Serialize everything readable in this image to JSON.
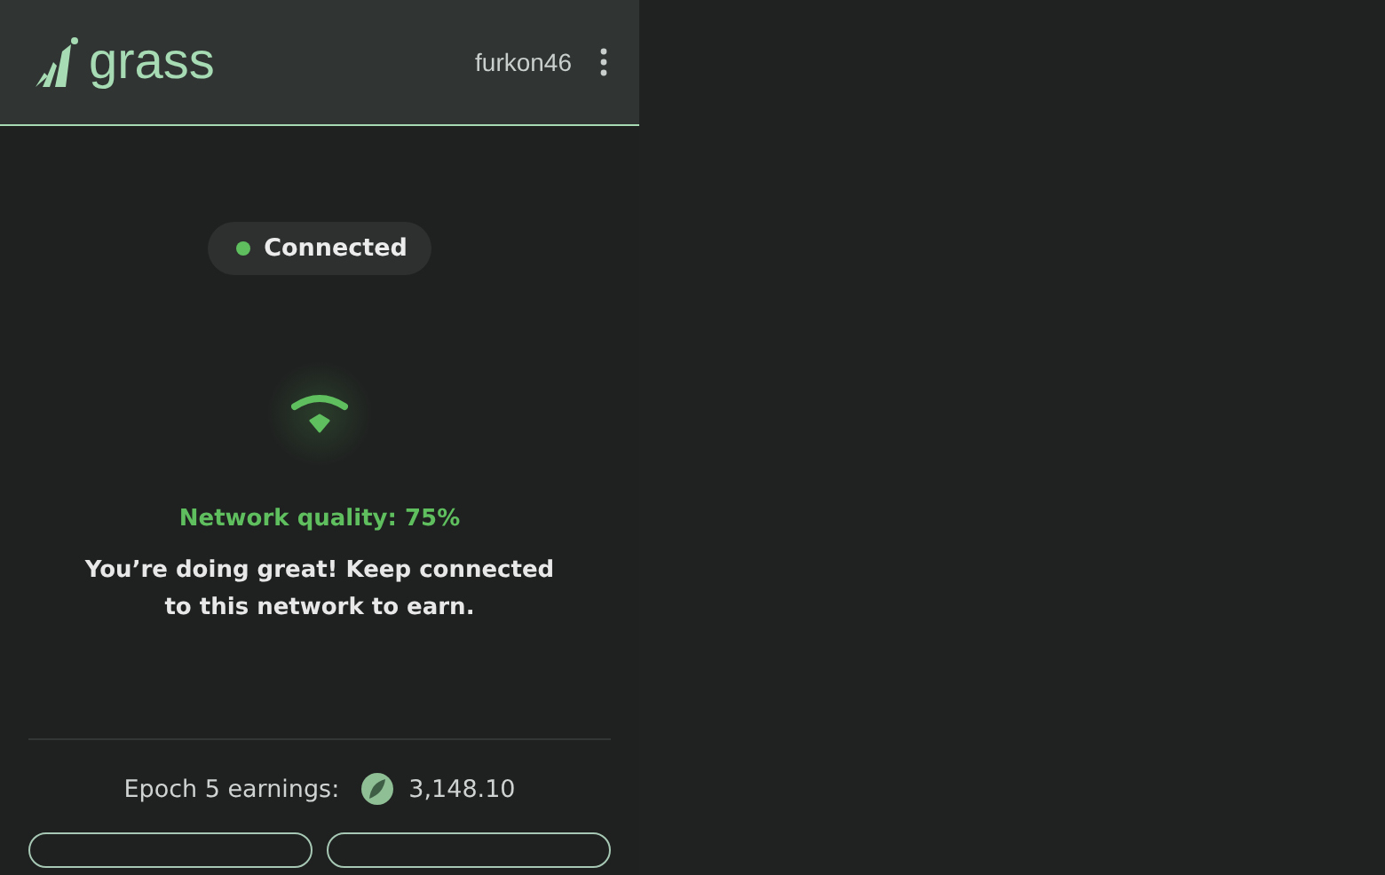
{
  "header": {
    "logo_text": "grass",
    "username": "furkon46"
  },
  "status": {
    "label": "Connected",
    "connected": true
  },
  "network": {
    "quality": "Network quality: 75%",
    "message": "You’re doing great! Keep connected to this network to earn."
  },
  "earnings": {
    "label": "Epoch 5 earnings:",
    "amount": "3,148.10"
  },
  "buttons": [
    {
      "kind": "outline"
    },
    {
      "kind": "outline"
    }
  ]
}
